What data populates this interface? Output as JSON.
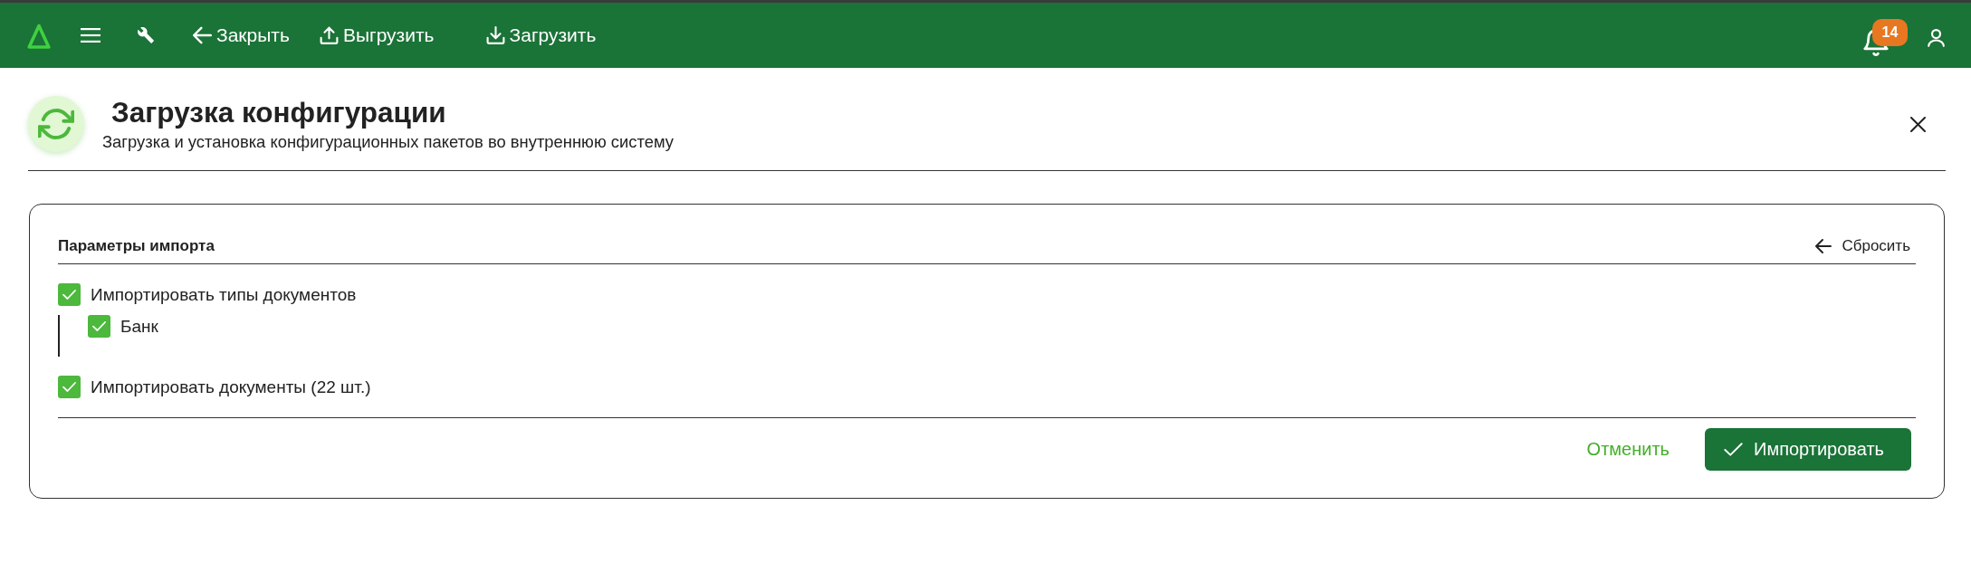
{
  "top_bar": {
    "actions": [
      {
        "kind": "back",
        "label": "Закрыть"
      },
      {
        "kind": "upload",
        "label": "Выгрузить"
      },
      {
        "kind": "download",
        "label": "Загрузить"
      }
    ],
    "notification_count": "14"
  },
  "header": {
    "title": "Загрузка конфигурации",
    "subtitle": "Загрузка и установка конфигурационных пакетов во внутреннюю систему"
  },
  "panel": {
    "title": "Параметры импорта",
    "reset": "Сбросить",
    "options": [
      {
        "label": "Импортировать типы документов",
        "checked": true,
        "children": [
          {
            "label": "Банк",
            "checked": true
          }
        ]
      },
      {
        "label": "Импортировать документы (22 шт.)",
        "checked": true
      }
    ]
  },
  "buttons": [
    {
      "kind": "secondary",
      "label": "Отменить"
    },
    {
      "kind": "primary",
      "label": "Импортировать"
    }
  ]
}
